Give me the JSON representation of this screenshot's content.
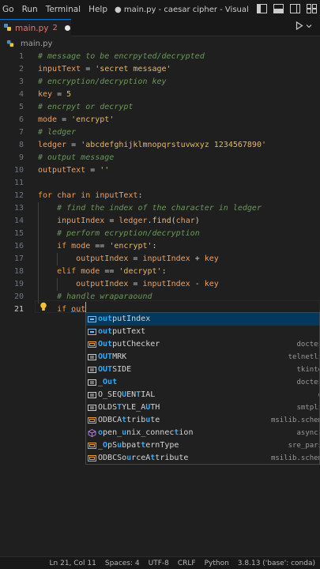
{
  "menu": {
    "items": [
      "Go",
      "Run",
      "Terminal",
      "Help"
    ]
  },
  "window": {
    "title": "● main.py - caesar cipher - Visual Studio C..."
  },
  "tab": {
    "icon": "python-file-icon",
    "name": "main.py",
    "badge": "2"
  },
  "breadcrumb": {
    "file": "main.py"
  },
  "editor": {
    "active_line": 21,
    "lines": [
      {
        "num": "1",
        "tokens": [
          [
            "c-com",
            "# message to be encrpyted/decrypted"
          ]
        ]
      },
      {
        "num": "2",
        "tokens": [
          [
            "c-var",
            "inputText"
          ],
          [
            "c-op",
            " = "
          ],
          [
            "c-str",
            "'secret message'"
          ]
        ]
      },
      {
        "num": "3",
        "tokens": [
          [
            "c-com",
            "# encryption/decryption key"
          ]
        ]
      },
      {
        "num": "4",
        "tokens": [
          [
            "c-var",
            "key"
          ],
          [
            "c-op",
            " = "
          ],
          [
            "c-num",
            "5"
          ]
        ]
      },
      {
        "num": "5",
        "tokens": [
          [
            "c-com",
            "# encrpyt or decrypt"
          ]
        ]
      },
      {
        "num": "6",
        "tokens": [
          [
            "c-var",
            "mode"
          ],
          [
            "c-op",
            " = "
          ],
          [
            "c-str",
            "'encrypt'"
          ]
        ]
      },
      {
        "num": "7",
        "tokens": [
          [
            "c-com",
            "# ledger"
          ]
        ]
      },
      {
        "num": "8",
        "tokens": [
          [
            "c-var",
            "ledger"
          ],
          [
            "c-op",
            " = "
          ],
          [
            "c-str",
            "'abcdefghijklmnopqrstuvwxyz 1234567890'"
          ]
        ]
      },
      {
        "num": "9",
        "tokens": [
          [
            "c-com",
            "# output message"
          ]
        ]
      },
      {
        "num": "10",
        "tokens": [
          [
            "c-var",
            "outputText"
          ],
          [
            "c-op",
            " = "
          ],
          [
            "c-str",
            "''"
          ]
        ]
      },
      {
        "num": "11",
        "tokens": []
      },
      {
        "num": "12",
        "tokens": [
          [
            "c-kw",
            "for"
          ],
          [
            "c-op",
            " "
          ],
          [
            "c-var",
            "char"
          ],
          [
            "c-op",
            " "
          ],
          [
            "c-kw",
            "in"
          ],
          [
            "c-op",
            " "
          ],
          [
            "c-var",
            "inputText"
          ],
          [
            "c-op",
            ":"
          ]
        ]
      },
      {
        "num": "13",
        "tokens": [
          [
            "c-op",
            "    "
          ],
          [
            "c-com",
            "# find the index of the character in ledger"
          ]
        ]
      },
      {
        "num": "14",
        "tokens": [
          [
            "c-op",
            "    "
          ],
          [
            "c-var",
            "inputIndex"
          ],
          [
            "c-op",
            " = "
          ],
          [
            "c-var",
            "ledger"
          ],
          [
            "c-op",
            "."
          ],
          [
            "c-fn",
            "find"
          ],
          [
            "c-op",
            "("
          ],
          [
            "c-var",
            "char"
          ],
          [
            "c-op",
            ")"
          ]
        ]
      },
      {
        "num": "15",
        "tokens": [
          [
            "c-op",
            "    "
          ],
          [
            "c-com",
            "# perform ecryption/decryption"
          ]
        ]
      },
      {
        "num": "16",
        "tokens": [
          [
            "c-op",
            "    "
          ],
          [
            "c-kw",
            "if"
          ],
          [
            "c-op",
            " "
          ],
          [
            "c-var",
            "mode"
          ],
          [
            "c-op",
            " == "
          ],
          [
            "c-str",
            "'encrypt'"
          ],
          [
            "c-op",
            ":"
          ]
        ]
      },
      {
        "num": "17",
        "tokens": [
          [
            "c-op",
            "        "
          ],
          [
            "c-var",
            "outputIndex"
          ],
          [
            "c-op",
            " = "
          ],
          [
            "c-var",
            "inputIndex"
          ],
          [
            "c-op",
            " + "
          ],
          [
            "c-var",
            "key"
          ]
        ]
      },
      {
        "num": "18",
        "tokens": [
          [
            "c-op",
            "    "
          ],
          [
            "c-kw",
            "elif"
          ],
          [
            "c-op",
            " "
          ],
          [
            "c-var",
            "mode"
          ],
          [
            "c-op",
            " == "
          ],
          [
            "c-str",
            "'decrypt'"
          ],
          [
            "c-op",
            ":"
          ]
        ]
      },
      {
        "num": "19",
        "tokens": [
          [
            "c-op",
            "        "
          ],
          [
            "c-var",
            "outputIndex"
          ],
          [
            "c-op",
            " = "
          ],
          [
            "c-var",
            "inputIndex"
          ],
          [
            "c-op",
            " - "
          ],
          [
            "c-var",
            "key"
          ]
        ]
      },
      {
        "num": "20",
        "tokens": [
          [
            "c-op",
            "    "
          ],
          [
            "c-com",
            "# handle wraparaound"
          ]
        ]
      },
      {
        "num": "21",
        "tokens": [
          [
            "c-op",
            "    "
          ],
          [
            "c-kw",
            "if"
          ],
          [
            "c-op",
            " "
          ],
          [
            "c-var",
            "out"
          ]
        ]
      }
    ]
  },
  "suggestions": {
    "typed": "out",
    "items": [
      {
        "kind": "variable",
        "pre": "",
        "match": "out",
        "post": "putIndex",
        "detail": "",
        "selected": true
      },
      {
        "kind": "variable",
        "pre": "",
        "match": "out",
        "post": "putText",
        "detail": ""
      },
      {
        "kind": "class",
        "pre": "",
        "match": "Out",
        "post": "putChecker",
        "detail": "doctes"
      },
      {
        "kind": "constant",
        "pre": "",
        "match": "OUT",
        "post": "MRK",
        "detail": "telnetli"
      },
      {
        "kind": "constant",
        "pre": "",
        "match": "OUT",
        "post": "SIDE",
        "detail": "tkinte"
      },
      {
        "kind": "constant",
        "pre": "_",
        "match": "Out",
        "post": "",
        "detail": "doctes"
      },
      {
        "kind": "constant",
        "pre": "O_SEQ",
        "match": "U",
        "post": "EN",
        "post2": "T",
        "post3": "IAL",
        "detail": "o"
      },
      {
        "kind": "constant",
        "pre": "O",
        "match": "",
        "post": "LDS",
        "post2": "T",
        "post3": "YLE_A",
        "post4": "U",
        "post5": "TH",
        "detail": "smtpli"
      },
      {
        "kind": "class",
        "pre": "O",
        "match": "",
        "post": "DBCA",
        "post2": "t",
        "post3": "trib",
        "post4": "u",
        "post5": "te",
        "detail": "msilib.schem"
      },
      {
        "kind": "function",
        "pre": "",
        "match": "o",
        "post": "pen_",
        "post2": "u",
        "post3": "nix_connec",
        "post4": "t",
        "post5": "ion",
        "detail": "asynci"
      },
      {
        "kind": "class",
        "pre": "_",
        "match": "O",
        "post": "pS",
        "post2": "u",
        "post3": "bpat",
        "post4": "t",
        "post5": "ernType",
        "detail": "sre_pars"
      },
      {
        "kind": "class",
        "pre": "O",
        "match": "",
        "post": "DBCSo",
        "post2": "u",
        "post3": "rceA",
        "post4": "t",
        "post5": "tribute",
        "detail": "msilib.schem"
      }
    ]
  },
  "status": {
    "position": "Ln 21, Col 11",
    "spaces": "Spaces: 4",
    "encoding": "UTF-8",
    "eol": "CRLF",
    "language": "Python",
    "interpreter": "3.8.13 ('base': conda)"
  },
  "colors": {
    "accent": "#0078d4",
    "selection": "#04395e",
    "match_highlight": "#2aaaff"
  }
}
